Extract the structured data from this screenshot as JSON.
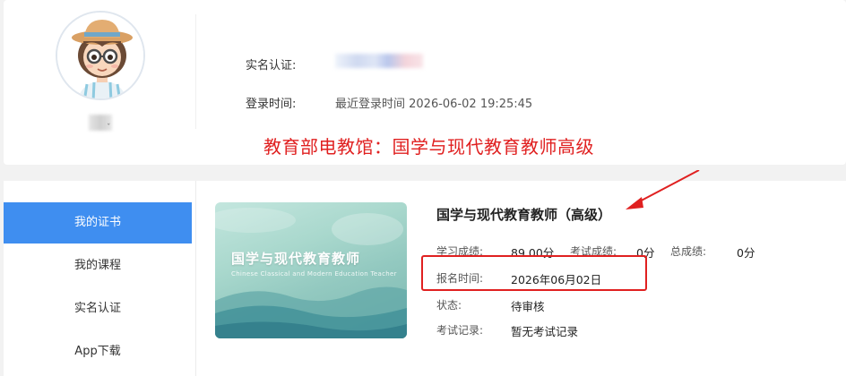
{
  "profile": {
    "username_mark": "ˇ",
    "realname_label": "实名认证:",
    "login_label": "登录时间:",
    "login_value": "最近登录时间 2026-06-02 19:25:45"
  },
  "annotation": {
    "title": "教育部电教馆：国学与现代教育教师高级",
    "color": "#e02020"
  },
  "sidebar": {
    "items": [
      {
        "label": "我的证书",
        "active": true
      },
      {
        "label": "我的课程"
      },
      {
        "label": "实名认证"
      },
      {
        "label": "App下载"
      }
    ],
    "active_color": "#3f8ef0"
  },
  "certificate": {
    "cover_title": "国学与现代教育教师",
    "cover_subtitle": "Chinese Classical and Modern Education Teacher",
    "title": "国学与现代教育教师（高级）",
    "study_score_label": "学习成绩:",
    "study_score_value": "89.00分",
    "exam_score_label": "考试成绩:",
    "exam_score_value": "0分",
    "total_score_label": "总成绩:",
    "total_score_value": "0分",
    "enroll_label": "报名时间:",
    "enroll_value": "2026年06月02日",
    "status_label": "状态:",
    "status_value": "待审核",
    "exam_record_label": "考试记录:",
    "exam_record_value": "暂无考试记录"
  }
}
